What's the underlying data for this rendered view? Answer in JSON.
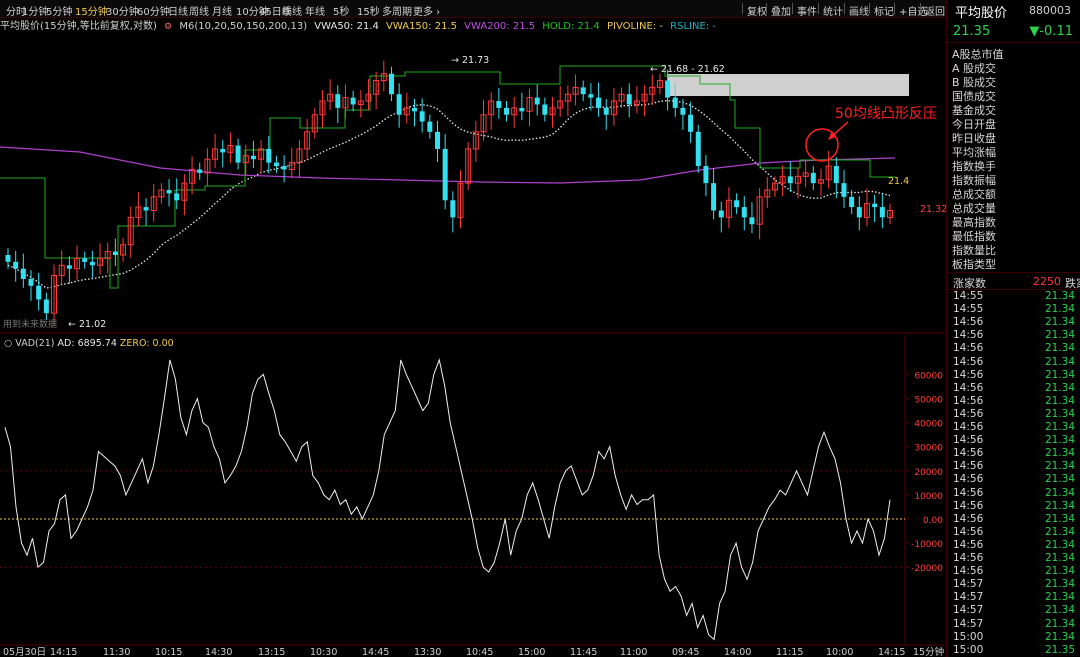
{
  "timeframes": [
    "分时",
    "1分钟",
    "5分钟",
    "15分钟",
    "30分钟",
    "60分钟",
    "日线",
    "周线",
    "月线",
    "10分钟",
    "45日线",
    "季线",
    "年线",
    "5秒",
    "15秒",
    "多周期",
    "更多 ›"
  ],
  "active_timeframe": "15分钟",
  "toolbar": [
    "复权",
    "叠加",
    "事件",
    "统计",
    "画线",
    "标记",
    "+自选",
    "返回"
  ],
  "legend": {
    "title": "平均股价(15分钟,等比前复权,对数)",
    "ma": "M6(10,20,50,150,200,13)",
    "vwa50": "VWA50: 21.4",
    "vwa150": "VWA150: 21.5",
    "vwa200": "VWA200: 21.5",
    "hold": "HOLD: 21.4",
    "pivoline": "PIVOLINE: -",
    "rsline": "RSLINE: -"
  },
  "chart_labels": {
    "high_label": "21.73",
    "low_label": "21.02",
    "range_label": "21.68 - 21.62",
    "right_label_1": "21.4",
    "right_label_2": "21.32",
    "future_data_note": "用到未来数据",
    "annotation": "50均线凸形反压"
  },
  "indicator": {
    "title": "VAD(21)",
    "ad": "AD: 6895.74",
    "zero": "ZERO: 0.00",
    "y_ticks": [
      "60000",
      "50000",
      "40000",
      "30000",
      "20000",
      "10000",
      "0.00",
      "-10000",
      "-20000"
    ]
  },
  "x_axis": [
    "05月30日",
    "14:15",
    "11:30",
    "10:15",
    "14:30",
    "13:15",
    "10:30",
    "14:45",
    "13:30",
    "10:45",
    "15:00",
    "11:45",
    "11:00",
    "09:45",
    "14:00",
    "11:15",
    "10:00",
    "14:15",
    "15分钟"
  ],
  "quote": {
    "name": "平均股价",
    "code": "880003",
    "price": "21.35",
    "change": "▼-0.11"
  },
  "menu": [
    "A股总市值",
    "A 股成交",
    "B 股成交",
    "国债成交",
    "基金成交",
    "今日开盘",
    "昨日收盘",
    "平均涨幅",
    "指数换手",
    "指数振幅",
    "总成交额",
    "总成交量",
    "最高指数",
    "最低指数",
    "指数量比",
    "板指类型"
  ],
  "breadth": {
    "label": "涨家数",
    "value": "2250",
    "next": "跌家"
  },
  "ticks": [
    {
      "t": "14:55",
      "p": "21.34"
    },
    {
      "t": "14:55",
      "p": "21.34"
    },
    {
      "t": "14:56",
      "p": "21.34"
    },
    {
      "t": "14:56",
      "p": "21.34"
    },
    {
      "t": "14:56",
      "p": "21.34"
    },
    {
      "t": "14:56",
      "p": "21.34"
    },
    {
      "t": "14:56",
      "p": "21.34"
    },
    {
      "t": "14:56",
      "p": "21.34"
    },
    {
      "t": "14:56",
      "p": "21.34"
    },
    {
      "t": "14:56",
      "p": "21.34"
    },
    {
      "t": "14:56",
      "p": "21.34"
    },
    {
      "t": "14:56",
      "p": "21.34"
    },
    {
      "t": "14:56",
      "p": "21.34"
    },
    {
      "t": "14:56",
      "p": "21.34"
    },
    {
      "t": "14:56",
      "p": "21.34"
    },
    {
      "t": "14:56",
      "p": "21.34"
    },
    {
      "t": "14:56",
      "p": "21.34"
    },
    {
      "t": "14:56",
      "p": "21.34"
    },
    {
      "t": "14:56",
      "p": "21.34"
    },
    {
      "t": "14:56",
      "p": "21.34"
    },
    {
      "t": "14:56",
      "p": "21.34"
    },
    {
      "t": "14:56",
      "p": "21.34"
    },
    {
      "t": "14:57",
      "p": "21.34"
    },
    {
      "t": "14:57",
      "p": "21.34"
    },
    {
      "t": "14:57",
      "p": "21.34"
    },
    {
      "t": "14:57",
      "p": "21.34"
    },
    {
      "t": "15:00",
      "p": "21.34"
    },
    {
      "t": "15:00",
      "p": "21.35"
    }
  ],
  "colors": {
    "up": "#ff3b3b",
    "down": "#33e0f0",
    "ma_white": "#e8e8e8",
    "ma_purple": "#b040d0",
    "hold": "#1faa1f",
    "accent_red": "#ff2020",
    "yellow": "#f2c94c"
  }
}
